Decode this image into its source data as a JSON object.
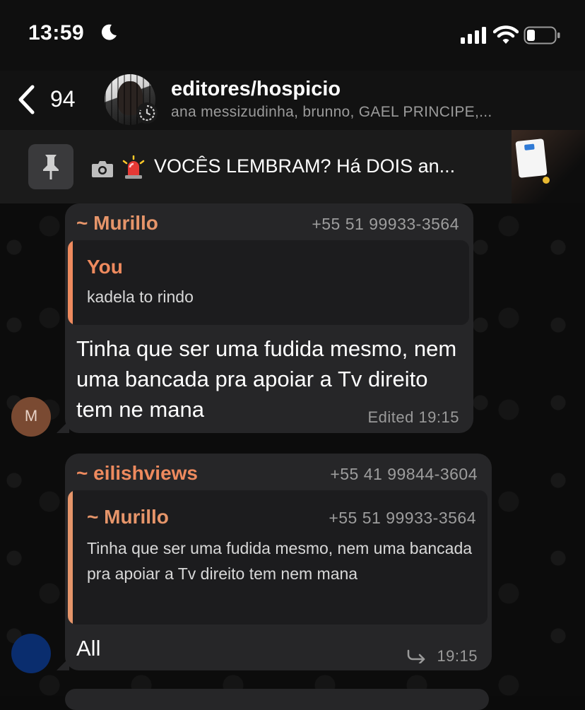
{
  "status_bar": {
    "time": "13:59",
    "icons": [
      "moon-icon",
      "signal-icon",
      "wifi-icon",
      "battery-icon"
    ]
  },
  "header": {
    "back_count": "94",
    "title": "editores/hospicio",
    "members": "ana messizudinha, brunno, GAEL PRINCIPE,..."
  },
  "pinned": {
    "text": "VOCÊS LEMBRAM? Há DOIS an...",
    "icons": [
      "pin-icon",
      "camera-icon",
      "siren-icon"
    ]
  },
  "messages": [
    {
      "sender": "~ Murillo",
      "phone": "+55 51 99933-3564",
      "sender_color": "#e6956a",
      "avatar_initial": "M",
      "quote": {
        "sender": "You",
        "sender_color": "#ee8a5e",
        "text": "kadela to rindo"
      },
      "text": "Tinha que ser uma fudida mesmo, nem uma bancada pra apoiar a Tv direito tem ne mana",
      "meta": "Edited 19:15"
    },
    {
      "sender": "~ eilishviews",
      "phone": "+55 41 99844-3604",
      "sender_color": "#ee8a5e",
      "avatar_color": "#0a2d6e",
      "quote": {
        "sender": "~ Murillo",
        "phone": "+55 51 99933-3564",
        "sender_color": "#e6956a",
        "text": "Tinha que ser uma fudida mesmo, nem uma bancada pra apoiar a Tv direito tem nem mana"
      },
      "text": "All",
      "meta": "19:15"
    }
  ]
}
